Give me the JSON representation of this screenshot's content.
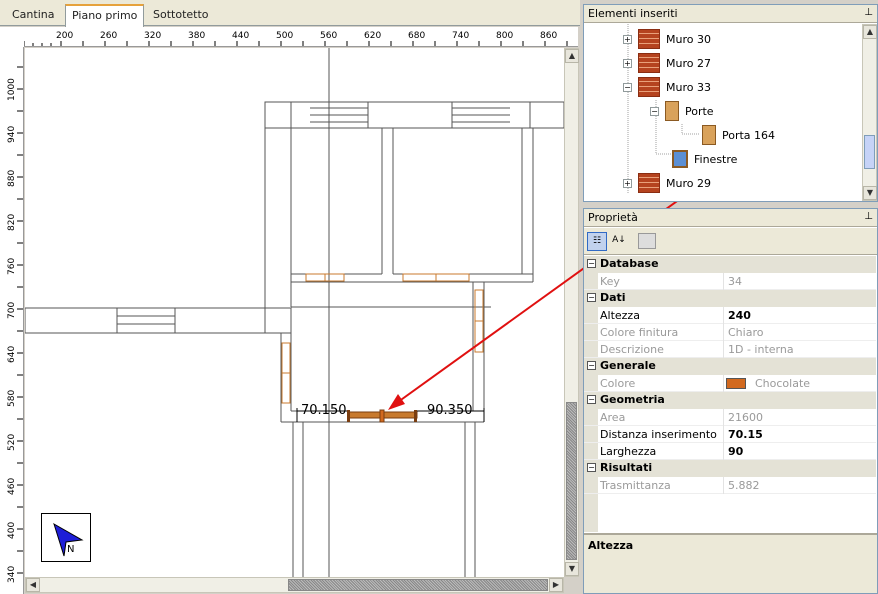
{
  "tabs": [
    "Cantina",
    "Piano primo",
    "Sottotetto"
  ],
  "active_tab": "Piano primo",
  "ruler_h": [
    "200",
    "260",
    "320",
    "380",
    "440",
    "500",
    "560",
    "620",
    "680",
    "740",
    "800",
    "860"
  ],
  "ruler_v": [
    "1000",
    "940",
    "880",
    "820",
    "760",
    "700",
    "640",
    "580",
    "520",
    "460",
    "400",
    "340"
  ],
  "dimensions": {
    "left": "70.150",
    "right": "90.350"
  },
  "tree": {
    "title": "Elementi inseriti",
    "items": [
      {
        "label": "Muro 30"
      },
      {
        "label": "Muro 27"
      },
      {
        "label": "Muro 33"
      },
      {
        "label": "Porte"
      },
      {
        "label": "Porta 164"
      },
      {
        "label": "Finestre"
      },
      {
        "label": "Muro 29"
      }
    ]
  },
  "props": {
    "title": "Proprietà",
    "categories": {
      "database": "Database",
      "dati": "Dati",
      "generale": "Generale",
      "geometria": "Geometria",
      "risultati": "Risultati"
    },
    "rows": {
      "key": {
        "label": "Key",
        "value": "34"
      },
      "altezza": {
        "label": "Altezza",
        "value": "240"
      },
      "colore_finitura": {
        "label": "Colore finitura",
        "value": "Chiaro"
      },
      "descrizione": {
        "label": "Descrizione",
        "value": "1D - interna"
      },
      "colore": {
        "label": "Colore",
        "value": "Chocolate"
      },
      "area": {
        "label": "Area",
        "value": "21600"
      },
      "distanza": {
        "label": "Distanza inserimento",
        "value": "70.15"
      },
      "larghezza": {
        "label": "Larghezza",
        "value": "90"
      },
      "trasmittanza": {
        "label": "Trasmittanza",
        "value": "5.882"
      }
    },
    "description_title": "Altezza"
  },
  "colors": {
    "accent_red": "#e01010",
    "chocolate": "#d2691e",
    "door": "#c87a2e"
  }
}
